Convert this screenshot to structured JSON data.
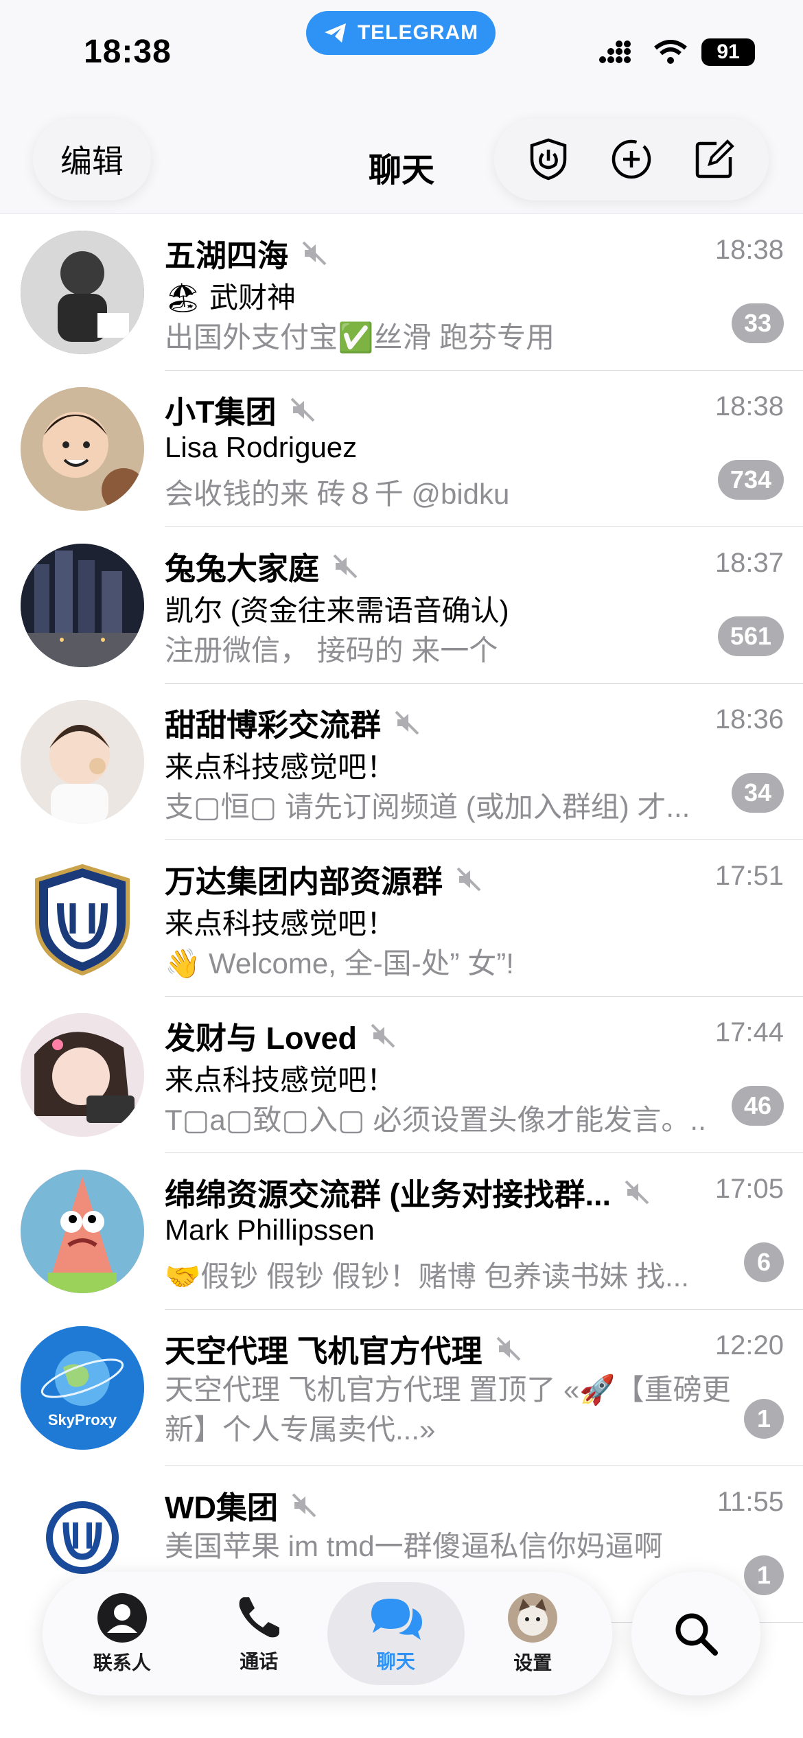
{
  "status": {
    "time": "18:38",
    "app_pill": "TELEGRAM",
    "battery": "91"
  },
  "header": {
    "edit": "编辑",
    "title": "聊天"
  },
  "chats": [
    {
      "title": "五湖四海",
      "time": "18:38",
      "sender": "🏖 武财神",
      "message": "出国外支付宝✅丝滑 跑芬专用",
      "badge": "33",
      "avatar_color": "#6b6b6b"
    },
    {
      "title": "小T集团",
      "time": "18:38",
      "sender": "Lisa Rodriguez",
      "message": "会收钱的来 砖８千 @bidku",
      "badge": "734",
      "avatar_color": "#c7b59a"
    },
    {
      "title": "兔兔大家庭",
      "time": "18:37",
      "sender": "凯尔 (资金往来需语音确认)",
      "message": "注册微信， 接码的 来一个",
      "badge": "561",
      "avatar_color": "#2b3348"
    },
    {
      "title": "甜甜博彩交流群",
      "time": "18:36",
      "sender": "来点科技感觉吧！",
      "message": "支▢恒▢ 请先订阅频道 (或加入群组) 才...",
      "badge": "34",
      "avatar_color": "#e6dfdb"
    },
    {
      "title": "万达集团内部资源群",
      "time": "17:51",
      "sender": "来点科技感觉吧！",
      "message": "👋 Welcome, 全-国-处” 女”!",
      "badge": "",
      "avatar_color": "#ffffff"
    },
    {
      "title": "发财与 Loved",
      "time": "17:44",
      "sender": "来点科技感觉吧！",
      "message": "T▢a▢致▢入▢ 必须设置头像才能发言。..",
      "badge": "46",
      "avatar_color": "#d9c8cf"
    },
    {
      "title": "绵绵资源交流群 (业务对接找群...",
      "time": "17:05",
      "sender": "Mark Phillipssen",
      "message": "🤝假钞 假钞 假钞！赌博 包养读书妹 找...",
      "badge": "6",
      "avatar_color": "#f08c7a"
    },
    {
      "title": "天空代理 飞机官方代理",
      "time": "12:20",
      "message_multi": "天空代理 飞机官方代理 置顶了 «🚀【重磅更新】个人专属卖代...»",
      "badge": "1",
      "avatar_text": "SkyProxy",
      "avatar_color": "#1f7ad6"
    },
    {
      "title": "WD集团",
      "time": "11:55",
      "message_multi": "美国苹果 im tmd一群傻逼私信你妈逼啊",
      "badge": "1",
      "avatar_color": "#ffffff"
    }
  ],
  "tabs": [
    {
      "label": "联系人",
      "icon": "person-circle-icon"
    },
    {
      "label": "通话",
      "icon": "phone-icon"
    },
    {
      "label": "聊天",
      "icon": "chat-bubbles-icon",
      "active": true
    },
    {
      "label": "设置",
      "icon": "profile-avatar-icon"
    }
  ],
  "colors": {
    "accent": "#2f93f5",
    "badge": "#aeaeb2",
    "secondary_text": "#8e8e93"
  }
}
